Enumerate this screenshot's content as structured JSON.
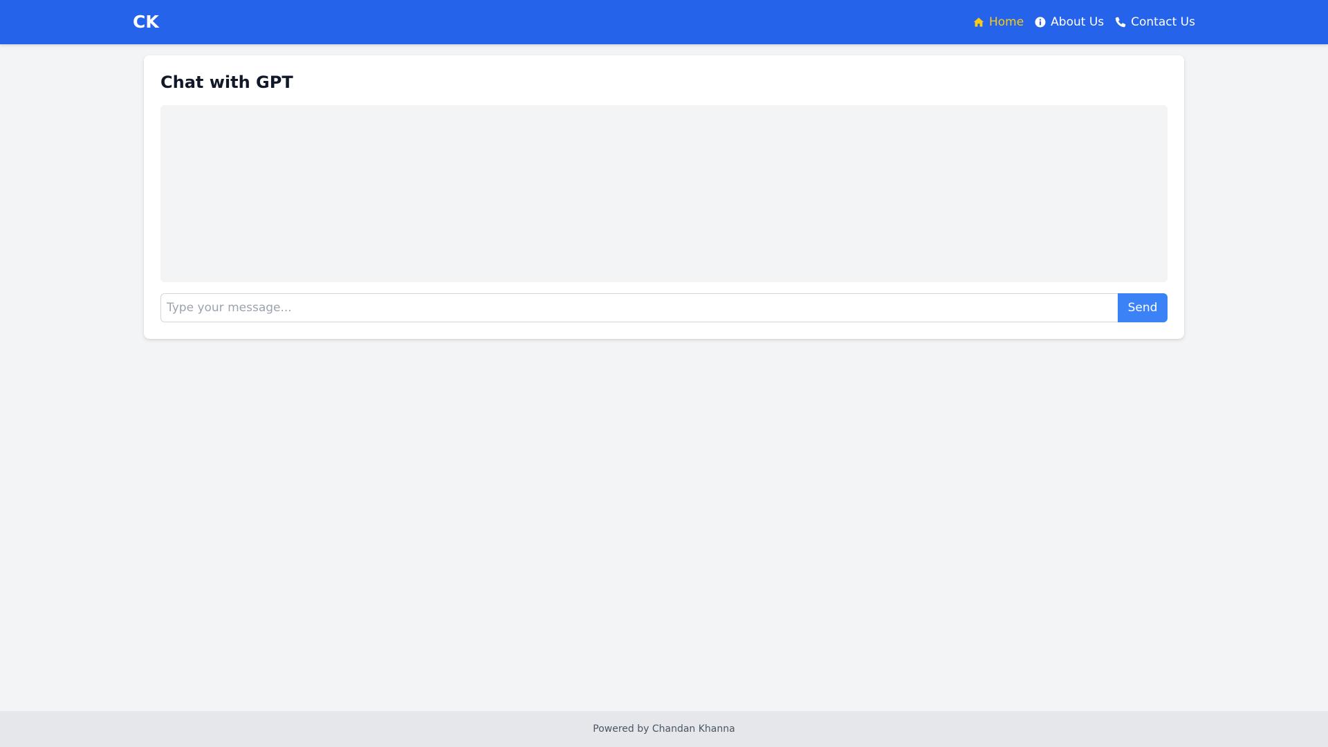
{
  "navbar": {
    "brand": "CK",
    "links": [
      {
        "label": "Home",
        "icon": "home-icon",
        "active": true
      },
      {
        "label": "About Us",
        "icon": "info-icon",
        "active": false
      },
      {
        "label": "Contact Us",
        "icon": "phone-icon",
        "active": false
      }
    ]
  },
  "chat": {
    "title": "Chat with GPT",
    "messages": [],
    "input_placeholder": "Type your message...",
    "input_value": "",
    "send_label": "Send"
  },
  "footer": {
    "text": "Powered by Chandan Khanna"
  },
  "colors": {
    "navbar_bg": "#2563eb",
    "active_link": "#facc15",
    "send_button": "#3b82f6",
    "page_bg": "#f3f4f6",
    "footer_bg": "#e5e7eb"
  }
}
